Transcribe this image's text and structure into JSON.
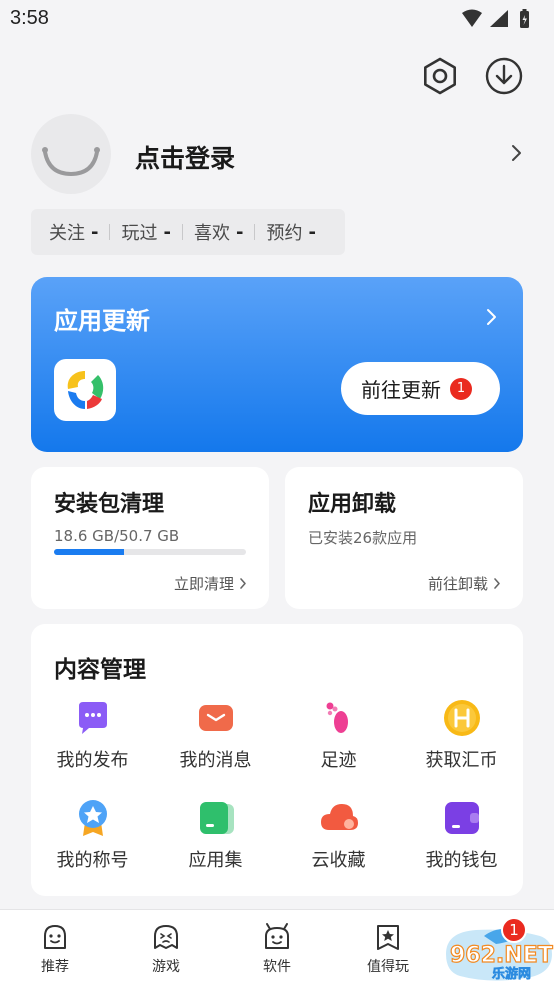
{
  "status_bar": {
    "time": "3:58"
  },
  "profile": {
    "login_text": "点击登录"
  },
  "stats": [
    {
      "label": "关注",
      "value": "-"
    },
    {
      "label": "玩过",
      "value": "-"
    },
    {
      "label": "喜欢",
      "value": "-"
    },
    {
      "label": "预约",
      "value": "-"
    }
  ],
  "update_card": {
    "title": "应用更新",
    "button_label": "前往更新",
    "badge_count": "1"
  },
  "clean_card": {
    "title": "安装包清理",
    "storage_text": "18.6 GB/50.7 GB",
    "storage_used_fraction": 0.367,
    "action_label": "立即清理"
  },
  "uninstall_card": {
    "title": "应用卸载",
    "subtitle": "已安装26款应用",
    "action_label": "前往卸载"
  },
  "content_management": {
    "title": "内容管理",
    "items": [
      {
        "label": "我的发布",
        "icon": "chat-bubble-icon"
      },
      {
        "label": "我的消息",
        "icon": "mail-icon"
      },
      {
        "label": "足迹",
        "icon": "footprint-icon"
      },
      {
        "label": "获取汇币",
        "icon": "coin-icon"
      },
      {
        "label": "我的称号",
        "icon": "medal-icon"
      },
      {
        "label": "应用集",
        "icon": "app-collection-icon"
      },
      {
        "label": "云收藏",
        "icon": "cloud-icon"
      },
      {
        "label": "我的钱包",
        "icon": "wallet-icon"
      }
    ]
  },
  "bottom_nav": {
    "items": [
      {
        "label": "推荐",
        "icon": "recommend-icon"
      },
      {
        "label": "游戏",
        "icon": "game-icon"
      },
      {
        "label": "软件",
        "icon": "software-icon"
      },
      {
        "label": "值得玩",
        "icon": "star-bookmark-icon"
      }
    ],
    "badge_count": "1"
  },
  "watermark": {
    "line1": "962.NET",
    "line2": "乐游网"
  },
  "colors": {
    "accent_blue": "#1a7cf0",
    "badge_red": "#ea2a1f",
    "background": "#f4f4f6"
  }
}
